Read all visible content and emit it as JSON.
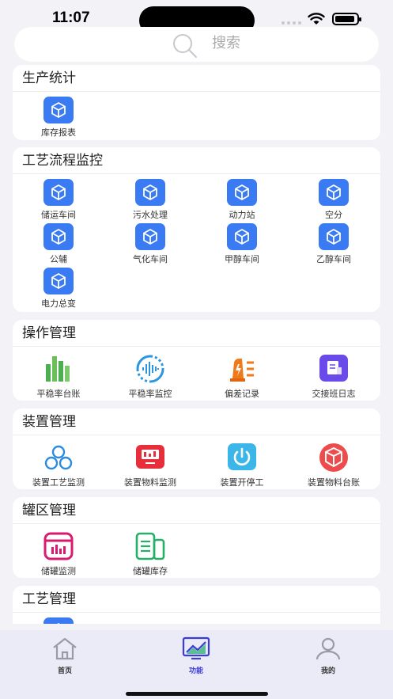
{
  "status_bar": {
    "time": "11:07"
  },
  "search": {
    "placeholder": "搜索"
  },
  "sections": {
    "production": {
      "title": "生产统计",
      "items": [
        "库存报表"
      ]
    },
    "process": {
      "title": "工艺流程监控",
      "items": [
        "储运车间",
        "污水处理",
        "动力站",
        "空分",
        "公辅",
        "气化车间",
        "甲醇车间",
        "乙醇车间",
        "电力总变"
      ]
    },
    "operation": {
      "title": "操作管理",
      "items": [
        "平稳率台账",
        "平稳率监控",
        "偏差记录",
        "交接班日志"
      ]
    },
    "device": {
      "title": "装置管理",
      "items": [
        "装置工艺监测",
        "装置物料监测",
        "装置开停工",
        "装置物料台账"
      ]
    },
    "tank": {
      "title": "罐区管理",
      "items": [
        "储罐监测",
        "储罐库存"
      ]
    },
    "craft": {
      "title": "工艺管理"
    }
  },
  "tabbar": {
    "items": [
      "首页",
      "功能",
      "我的"
    ],
    "active": "功能"
  },
  "colors": {
    "accent": "#3a7af2",
    "tab_active": "#3b3bd8",
    "background": "#f2f2f7"
  }
}
